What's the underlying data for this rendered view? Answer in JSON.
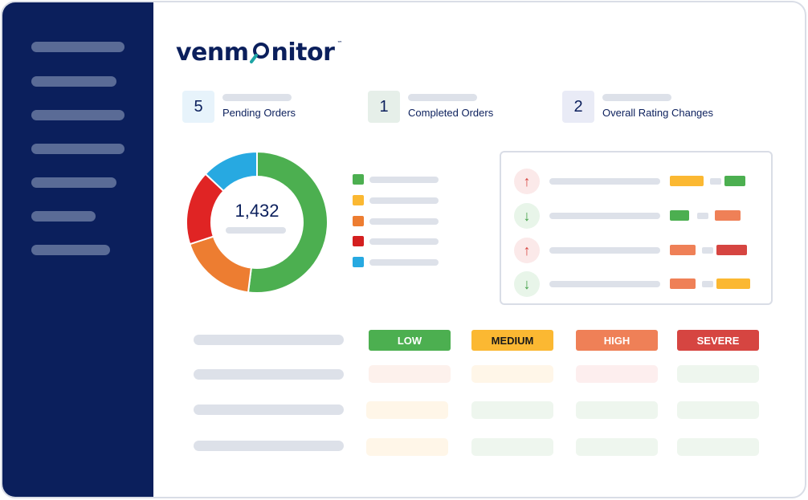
{
  "brand": {
    "name_part1": "venm",
    "name_part2": "nitor",
    "tm": "™",
    "icon": "magnifier-icon"
  },
  "stats": [
    {
      "value": "5",
      "label": "Pending Orders",
      "bg": "#e7f3fb"
    },
    {
      "value": "1",
      "label": "Completed Orders",
      "bg": "#e6efe9"
    },
    {
      "value": "2",
      "label": "Overall Rating Changes",
      "bg": "#e9ebf6"
    }
  ],
  "donut": {
    "total": "1,432",
    "segments": [
      {
        "value": 0.52,
        "color": "#4caf50"
      },
      {
        "value": 0.18,
        "color": "#ed7d31"
      },
      {
        "value": 0.17,
        "color": "#e02424"
      },
      {
        "value": 0.13,
        "color": "#27a9e1"
      }
    ]
  },
  "legend_colors": [
    "#4caf50",
    "#fbb832",
    "#ed7d31",
    "#d41f1f",
    "#27a9e1"
  ],
  "trends": [
    {
      "dir": "up",
      "icon": "arrow-up-icon",
      "glyph": "↑",
      "c1": "#fbb832",
      "c2": "#4caf50"
    },
    {
      "dir": "down",
      "icon": "arrow-down-icon",
      "glyph": "↓",
      "c1": "#4caf50",
      "c2": "#ef8057"
    },
    {
      "dir": "up",
      "icon": "arrow-up-icon",
      "glyph": "↑",
      "c1": "#ef8057",
      "c2": "#d64541"
    },
    {
      "dir": "down",
      "icon": "arrow-down-icon",
      "glyph": "↓",
      "c1": "#ef8057",
      "c2": "#fbb832"
    }
  ],
  "severity": {
    "headers": [
      {
        "label": "LOW",
        "bg": "#4caf50",
        "fg": "#ffffff"
      },
      {
        "label": "MEDIUM",
        "bg": "#fbb832",
        "fg": "#1a1a1a"
      },
      {
        "label": "HIGH",
        "bg": "#ef8057",
        "fg": "#ffffff"
      },
      {
        "label": "SEVERE",
        "bg": "#d64541",
        "fg": "#ffffff"
      }
    ],
    "rows": [
      [
        "#fdf1ec",
        "#fff6e8",
        "#fdeeee",
        "#eef6ee"
      ],
      [
        "#fff6e8",
        "#eef6ee",
        "#eef6ee",
        "#eef6ee"
      ],
      [
        "#fff6e8",
        "#eef6ee",
        "#eef6ee",
        "#eef6ee"
      ]
    ]
  }
}
